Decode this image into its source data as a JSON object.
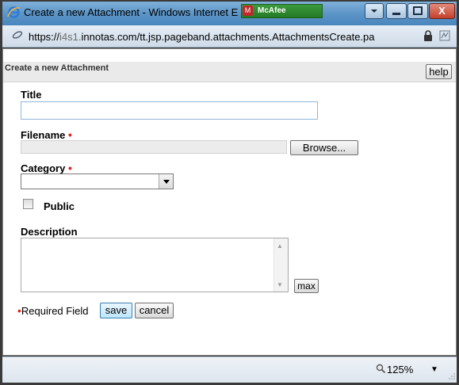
{
  "window": {
    "title": "Create a new Attachment - Windows Internet E",
    "mcafee_label": "McAfee",
    "close_glyph": "X"
  },
  "address": {
    "url_prefix": "https://",
    "url_host_dim": "i4s1.",
    "url_host": "innotas.com",
    "url_path": "/tt.jsp.pageband.attachments.AttachmentsCreate.pa"
  },
  "header": {
    "title": "Create a new Attachment",
    "help_label": "help"
  },
  "form": {
    "title_label": "Title",
    "title_value": "",
    "filename_label": "Filename",
    "required_marker": "•",
    "browse_label": "Browse...",
    "category_label": "Category",
    "category_value": "",
    "public_label": "Public",
    "public_checked": false,
    "description_label": "Description",
    "description_value": "",
    "max_label": "max",
    "required_note": "Required Field",
    "save_label": "save",
    "cancel_label": "cancel"
  },
  "status": {
    "zoom": "125%"
  },
  "icons": {
    "title": "internet-explorer-icon",
    "address": "page-icon",
    "lock": "lock-icon",
    "compat": "compatibility-view-icon",
    "zoom": "magnifier-icon"
  },
  "colors": {
    "required": "#e2231a",
    "title_bar": "#5a93c6",
    "save_border": "#3c7fb1"
  }
}
